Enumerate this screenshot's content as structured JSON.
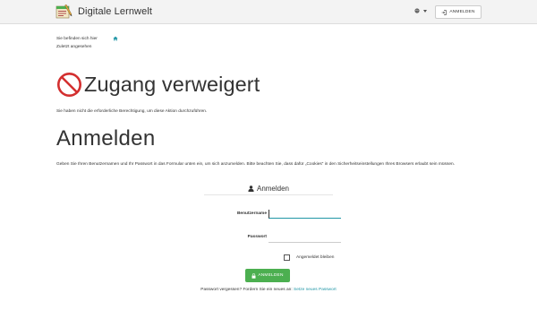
{
  "brand": {
    "name": "Digitale Lernwelt"
  },
  "navbar": {
    "login_label": "ANMELDEN",
    "language_icon": "globe-icon"
  },
  "breadcrumb": {
    "location_label": "Sie befinden sich hier",
    "home_icon": "home-icon"
  },
  "recent": {
    "label": "Zuletzt angesehen"
  },
  "access_denied": {
    "title": "Zugang verweigert",
    "message": "Sie haben nicht die erforderliche Berechtigung, um diese Aktion durchzuführen."
  },
  "login": {
    "heading": "Anmelden",
    "info": "Geben Sie Ihren Benutzernamen und Ihr Passwort in das Formular unten ein, um sich anzumelden. Bitte beachten Sie, dass dafür „Cookies“ in den Sicherheitseinstellungen Ihres Browsers erlaubt sein müssen.",
    "form_title": "Anmelden",
    "username_label": "Benutzername",
    "username_value": "",
    "password_label": "Passwort",
    "password_value": "",
    "remember_label": "Angemeldet bleiben",
    "remember_checked": false,
    "submit_label": "ANMELDEN",
    "forgot_text": "Passwort vergessen? Fordern Sie ein neues an:",
    "forgot_link": "Setze neues Passwort"
  },
  "colors": {
    "accent": "#2196a6",
    "success": "#4caf50",
    "danger": "#d32f2f",
    "navbar_bg": "#f3f3f3"
  }
}
